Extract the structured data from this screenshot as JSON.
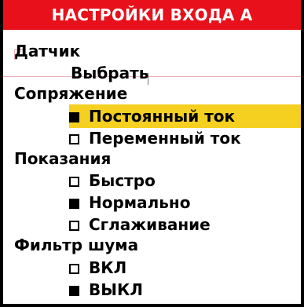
{
  "title": "НАСТРОЙКИ ВХОДА А",
  "colors": {
    "title_bar": "#e8101a",
    "highlight": "#f5d020",
    "text": "#000000"
  },
  "sensor": {
    "label": "Датчик",
    "button_label": "Выбрать"
  },
  "coupling": {
    "label": "Сопряжение",
    "options": [
      {
        "label": "Постоянный ток",
        "checked": true,
        "highlighted": true
      },
      {
        "label": "Переменный ток",
        "checked": false,
        "highlighted": false
      }
    ]
  },
  "readings": {
    "label": "Показания",
    "options": [
      {
        "label": "Быстро",
        "checked": false
      },
      {
        "label": "Нормально",
        "checked": true
      },
      {
        "label": "Сглаживание",
        "checked": false
      }
    ]
  },
  "noise_filter": {
    "label": "Фильтр шума",
    "options": [
      {
        "label": "ВКЛ",
        "checked": false
      },
      {
        "label": "ВЫКЛ",
        "checked": true
      }
    ]
  }
}
